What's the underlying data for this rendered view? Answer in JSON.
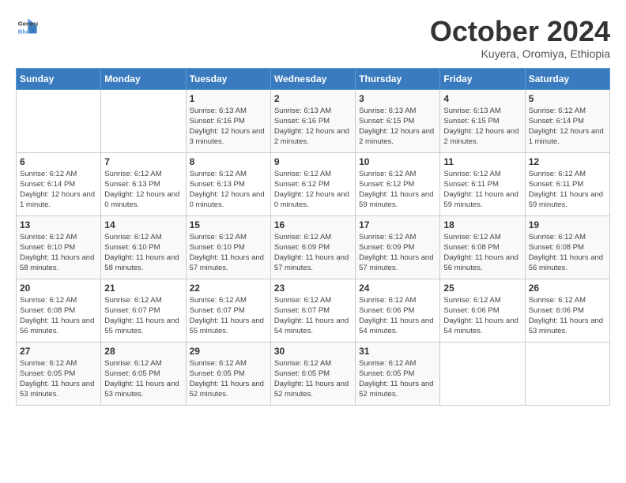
{
  "logo": {
    "line1": "General",
    "line2": "Blue"
  },
  "title": "October 2024",
  "subtitle": "Kuyera, Oromiya, Ethiopia",
  "days_header": [
    "Sunday",
    "Monday",
    "Tuesday",
    "Wednesday",
    "Thursday",
    "Friday",
    "Saturday"
  ],
  "weeks": [
    [
      {
        "num": "",
        "info": ""
      },
      {
        "num": "",
        "info": ""
      },
      {
        "num": "1",
        "info": "Sunrise: 6:13 AM\nSunset: 6:16 PM\nDaylight: 12 hours and 3 minutes."
      },
      {
        "num": "2",
        "info": "Sunrise: 6:13 AM\nSunset: 6:16 PM\nDaylight: 12 hours and 2 minutes."
      },
      {
        "num": "3",
        "info": "Sunrise: 6:13 AM\nSunset: 6:15 PM\nDaylight: 12 hours and 2 minutes."
      },
      {
        "num": "4",
        "info": "Sunrise: 6:13 AM\nSunset: 6:15 PM\nDaylight: 12 hours and 2 minutes."
      },
      {
        "num": "5",
        "info": "Sunrise: 6:12 AM\nSunset: 6:14 PM\nDaylight: 12 hours and 1 minute."
      }
    ],
    [
      {
        "num": "6",
        "info": "Sunrise: 6:12 AM\nSunset: 6:14 PM\nDaylight: 12 hours and 1 minute."
      },
      {
        "num": "7",
        "info": "Sunrise: 6:12 AM\nSunset: 6:13 PM\nDaylight: 12 hours and 0 minutes."
      },
      {
        "num": "8",
        "info": "Sunrise: 6:12 AM\nSunset: 6:13 PM\nDaylight: 12 hours and 0 minutes."
      },
      {
        "num": "9",
        "info": "Sunrise: 6:12 AM\nSunset: 6:12 PM\nDaylight: 12 hours and 0 minutes."
      },
      {
        "num": "10",
        "info": "Sunrise: 6:12 AM\nSunset: 6:12 PM\nDaylight: 11 hours and 59 minutes."
      },
      {
        "num": "11",
        "info": "Sunrise: 6:12 AM\nSunset: 6:11 PM\nDaylight: 11 hours and 59 minutes."
      },
      {
        "num": "12",
        "info": "Sunrise: 6:12 AM\nSunset: 6:11 PM\nDaylight: 11 hours and 59 minutes."
      }
    ],
    [
      {
        "num": "13",
        "info": "Sunrise: 6:12 AM\nSunset: 6:10 PM\nDaylight: 11 hours and 58 minutes."
      },
      {
        "num": "14",
        "info": "Sunrise: 6:12 AM\nSunset: 6:10 PM\nDaylight: 11 hours and 58 minutes."
      },
      {
        "num": "15",
        "info": "Sunrise: 6:12 AM\nSunset: 6:10 PM\nDaylight: 11 hours and 57 minutes."
      },
      {
        "num": "16",
        "info": "Sunrise: 6:12 AM\nSunset: 6:09 PM\nDaylight: 11 hours and 57 minutes."
      },
      {
        "num": "17",
        "info": "Sunrise: 6:12 AM\nSunset: 6:09 PM\nDaylight: 11 hours and 57 minutes."
      },
      {
        "num": "18",
        "info": "Sunrise: 6:12 AM\nSunset: 6:08 PM\nDaylight: 11 hours and 56 minutes."
      },
      {
        "num": "19",
        "info": "Sunrise: 6:12 AM\nSunset: 6:08 PM\nDaylight: 11 hours and 56 minutes."
      }
    ],
    [
      {
        "num": "20",
        "info": "Sunrise: 6:12 AM\nSunset: 6:08 PM\nDaylight: 11 hours and 56 minutes."
      },
      {
        "num": "21",
        "info": "Sunrise: 6:12 AM\nSunset: 6:07 PM\nDaylight: 11 hours and 55 minutes."
      },
      {
        "num": "22",
        "info": "Sunrise: 6:12 AM\nSunset: 6:07 PM\nDaylight: 11 hours and 55 minutes."
      },
      {
        "num": "23",
        "info": "Sunrise: 6:12 AM\nSunset: 6:07 PM\nDaylight: 11 hours and 54 minutes."
      },
      {
        "num": "24",
        "info": "Sunrise: 6:12 AM\nSunset: 6:06 PM\nDaylight: 11 hours and 54 minutes."
      },
      {
        "num": "25",
        "info": "Sunrise: 6:12 AM\nSunset: 6:06 PM\nDaylight: 11 hours and 54 minutes."
      },
      {
        "num": "26",
        "info": "Sunrise: 6:12 AM\nSunset: 6:06 PM\nDaylight: 11 hours and 53 minutes."
      }
    ],
    [
      {
        "num": "27",
        "info": "Sunrise: 6:12 AM\nSunset: 6:05 PM\nDaylight: 11 hours and 53 minutes."
      },
      {
        "num": "28",
        "info": "Sunrise: 6:12 AM\nSunset: 6:05 PM\nDaylight: 11 hours and 53 minutes."
      },
      {
        "num": "29",
        "info": "Sunrise: 6:12 AM\nSunset: 6:05 PM\nDaylight: 11 hours and 52 minutes."
      },
      {
        "num": "30",
        "info": "Sunrise: 6:12 AM\nSunset: 6:05 PM\nDaylight: 11 hours and 52 minutes."
      },
      {
        "num": "31",
        "info": "Sunrise: 6:12 AM\nSunset: 6:05 PM\nDaylight: 11 hours and 52 minutes."
      },
      {
        "num": "",
        "info": ""
      },
      {
        "num": "",
        "info": ""
      }
    ]
  ]
}
